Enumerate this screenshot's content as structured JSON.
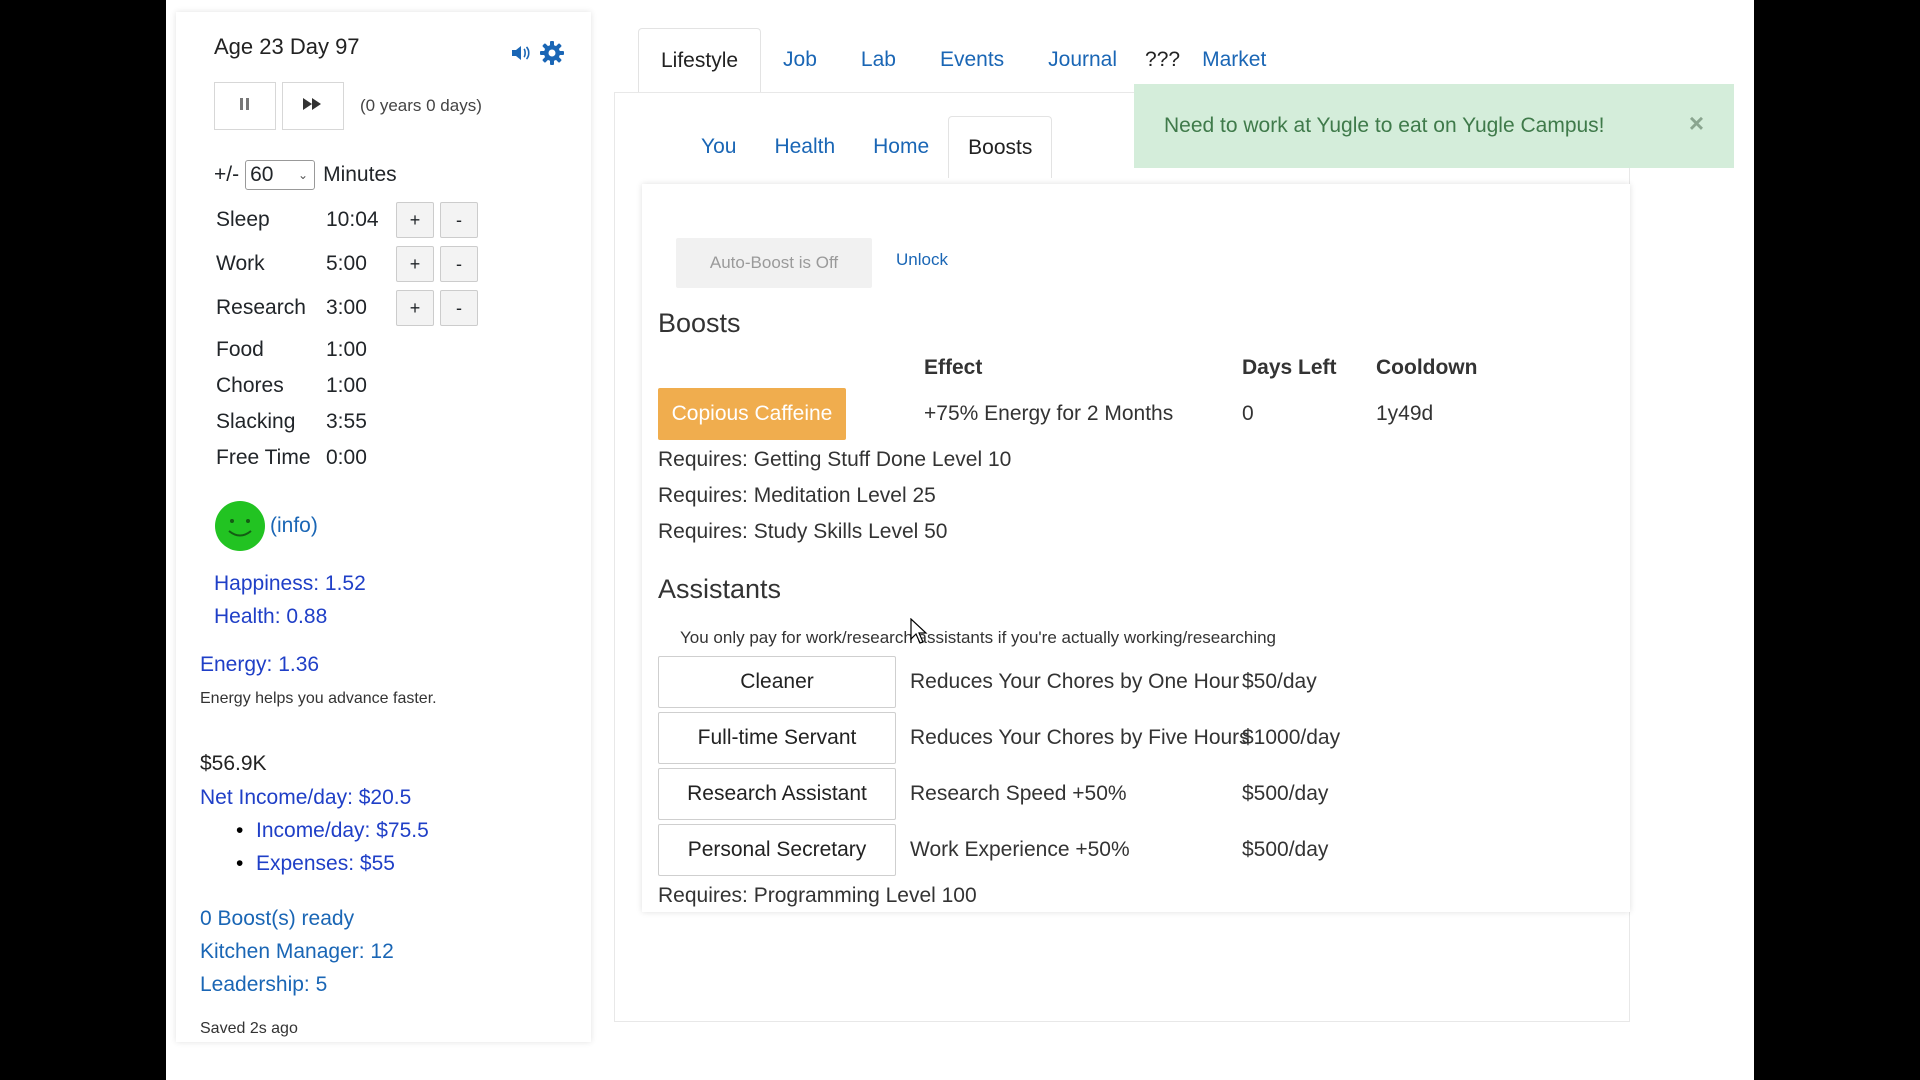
{
  "sidebar": {
    "age": "Age 23 Day 97",
    "elapsed": "(0 years 0 days)",
    "pause_icon": "pause-icon",
    "play_icon": "fast-forward-icon",
    "minutes_prefix": "+/-",
    "minutes_value": "60",
    "minutes_label": "Minutes",
    "time_rows": [
      {
        "label": "Sleep",
        "value": "10:04"
      },
      {
        "label": "Work",
        "value": "5:00"
      },
      {
        "label": "Research",
        "value": "3:00"
      },
      {
        "label": "Food",
        "value": "1:00"
      },
      {
        "label": "Chores",
        "value": "1:00"
      },
      {
        "label": "Slacking",
        "value": "3:55"
      },
      {
        "label": "Free Time",
        "value": "0:00"
      }
    ],
    "plus": "+",
    "minus": "-",
    "info": "(info)",
    "happiness": "Happiness: 1.52",
    "health": "Health: 0.88",
    "energy": "Energy: 1.36",
    "energy_note": "Energy helps you advance faster.",
    "money": "$56.9K",
    "net_income": "Net Income/day: $20.5",
    "income": "Income/day: $75.5",
    "expenses": "Expenses: $55",
    "boosts_ready": "0 Boost(s) ready",
    "kitchen_manager": "Kitchen Manager: 12",
    "leadership": "Leadership: 5",
    "saved": "Saved 2s ago"
  },
  "tabs": [
    "Lifestyle",
    "Job",
    "Lab",
    "Events",
    "Journal",
    "???",
    "Market"
  ],
  "subtabs": [
    "You",
    "Health",
    "Home",
    "Boosts"
  ],
  "toast": {
    "message": "Need to work at Yugle to eat on Yugle Campus!",
    "close": "×"
  },
  "boosts": {
    "autoboost": "Auto-Boost is Off",
    "unlock": "Unlock",
    "heading": "Boosts",
    "col_effect": "Effect",
    "col_days_left": "Days Left",
    "col_cooldown": "Cooldown",
    "item": {
      "name": "Copious Caffeine",
      "effect": "+75% Energy for 2 Months",
      "days_left": "0",
      "cooldown": "1y49d"
    },
    "requirements": [
      "Requires: Getting Stuff Done Level 10",
      "Requires: Meditation Level 25",
      "Requires: Study Skills Level 50"
    ]
  },
  "assistants": {
    "heading": "Assistants",
    "note": "You only pay for work/research assistants if you're actually working/researching",
    "items": [
      {
        "name": "Cleaner",
        "effect": "Reduces Your Chores by One Hour",
        "cost": "$50/day"
      },
      {
        "name": "Full-time Servant",
        "effect": "Reduces Your Chores by Five Hours",
        "cost": "$1000/day"
      },
      {
        "name": "Research Assistant",
        "effect": "Research Speed +50%",
        "cost": "$500/day"
      },
      {
        "name": "Personal Secretary",
        "effect": "Work Experience +50%",
        "cost": "$500/day"
      }
    ],
    "requirement": "Requires: Programming Level 100"
  },
  "colors": {
    "accent_link": "#1a66b5",
    "boost_button": "#f0ad4e",
    "toast_bg": "#d4edda",
    "smiley": "#22c322"
  }
}
